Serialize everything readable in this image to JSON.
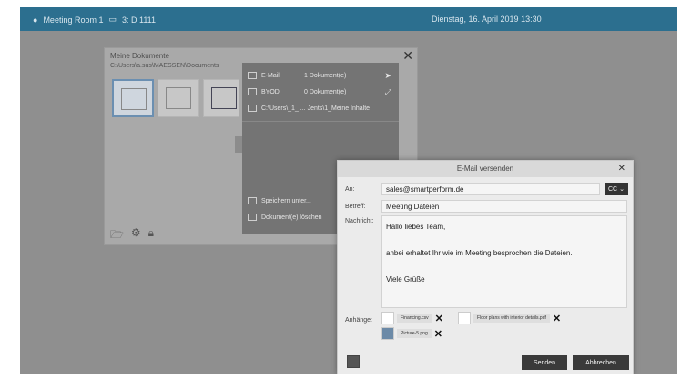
{
  "topbar": {
    "room_label": "Meeting Room 1",
    "device_label": "3:  D 1111",
    "datetime": "Dienstag, 16. April 2019  13:30"
  },
  "docs": {
    "title": "Meine Dokumente",
    "path": "C:\\Users\\a.sus\\MAESSEN\\Documents",
    "bottom_icons": [
      "folder-icon",
      "settings-icon",
      "lock-icon"
    ]
  },
  "menu": {
    "items": [
      {
        "label": "E-Mail",
        "count": "1 Dokument(e)",
        "icon": "send-icon"
      },
      {
        "label": "BYOD",
        "count": "0 Dokument(e)",
        "icon": "byod-icon"
      },
      {
        "label": "C:\\Users\\_1_ ... Jents\\1_Meine Inhalte",
        "count": "",
        "icon": ""
      },
      {
        "label": "Speichern unter...",
        "count": "",
        "icon": ""
      },
      {
        "label": "Dokument(e) löschen",
        "count": "",
        "icon": ""
      }
    ]
  },
  "dialog": {
    "title": "E-Mail versenden",
    "to_label": "An:",
    "to_value": "sales@smartperform.de",
    "cc_label": "CC",
    "subject_label": "Betreff:",
    "subject_value": "Meeting Dateien",
    "message_label": "Nachricht:",
    "message_lines": [
      "Hallo liebes Team,",
      "anbei erhaltet Ihr wie im Meeting besprochen die Dateien.",
      "Viele Grüße"
    ],
    "attachments_label": "Anhänge:",
    "attachments": [
      "Financing.csv",
      "Floor plans with interior details.pdf",
      "Picture-5.png"
    ],
    "send_label": "Senden",
    "cancel_label": "Abbrechen"
  }
}
